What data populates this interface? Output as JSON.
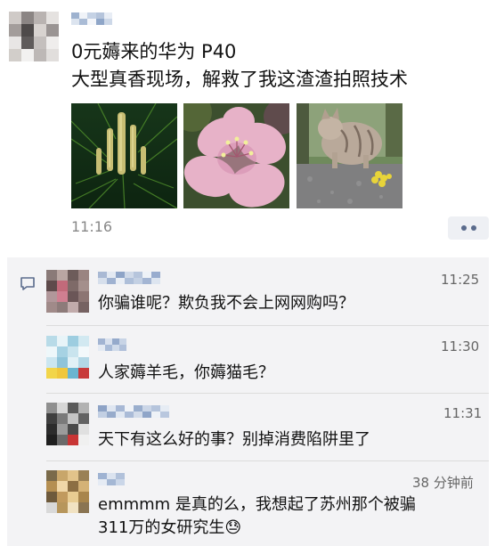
{
  "post": {
    "text_lines": [
      "0元薅来的华为 P40",
      "大型真香现场，解救了我这渣渣拍照技术"
    ],
    "time": "11:16",
    "photos": [
      "pine-sprouts-photo",
      "pink-blossom-photo",
      "cat-on-stone-photo"
    ]
  },
  "comments": [
    {
      "time": "11:25",
      "text": "你骗谁呢？欺负我不会上网网购吗？"
    },
    {
      "time": "11:30",
      "text": "人家薅羊毛，你薅猫毛？"
    },
    {
      "time": "11:31",
      "text": "天下有这么好的事？别掉消费陷阱里了"
    },
    {
      "time": "38 分钟前",
      "text_lines": [
        "emmmm 是真的么，我想起了苏州那个被骗",
        "311万的女研究生"
      ],
      "emoji": "😓"
    }
  ],
  "icons": {
    "comment": "comment-icon",
    "more": "more-dots-icon"
  },
  "colors": {
    "comment_bg": "#f3f3f5",
    "more_btn_bg": "#eef0f4",
    "more_dots": "#5a6b8c"
  }
}
